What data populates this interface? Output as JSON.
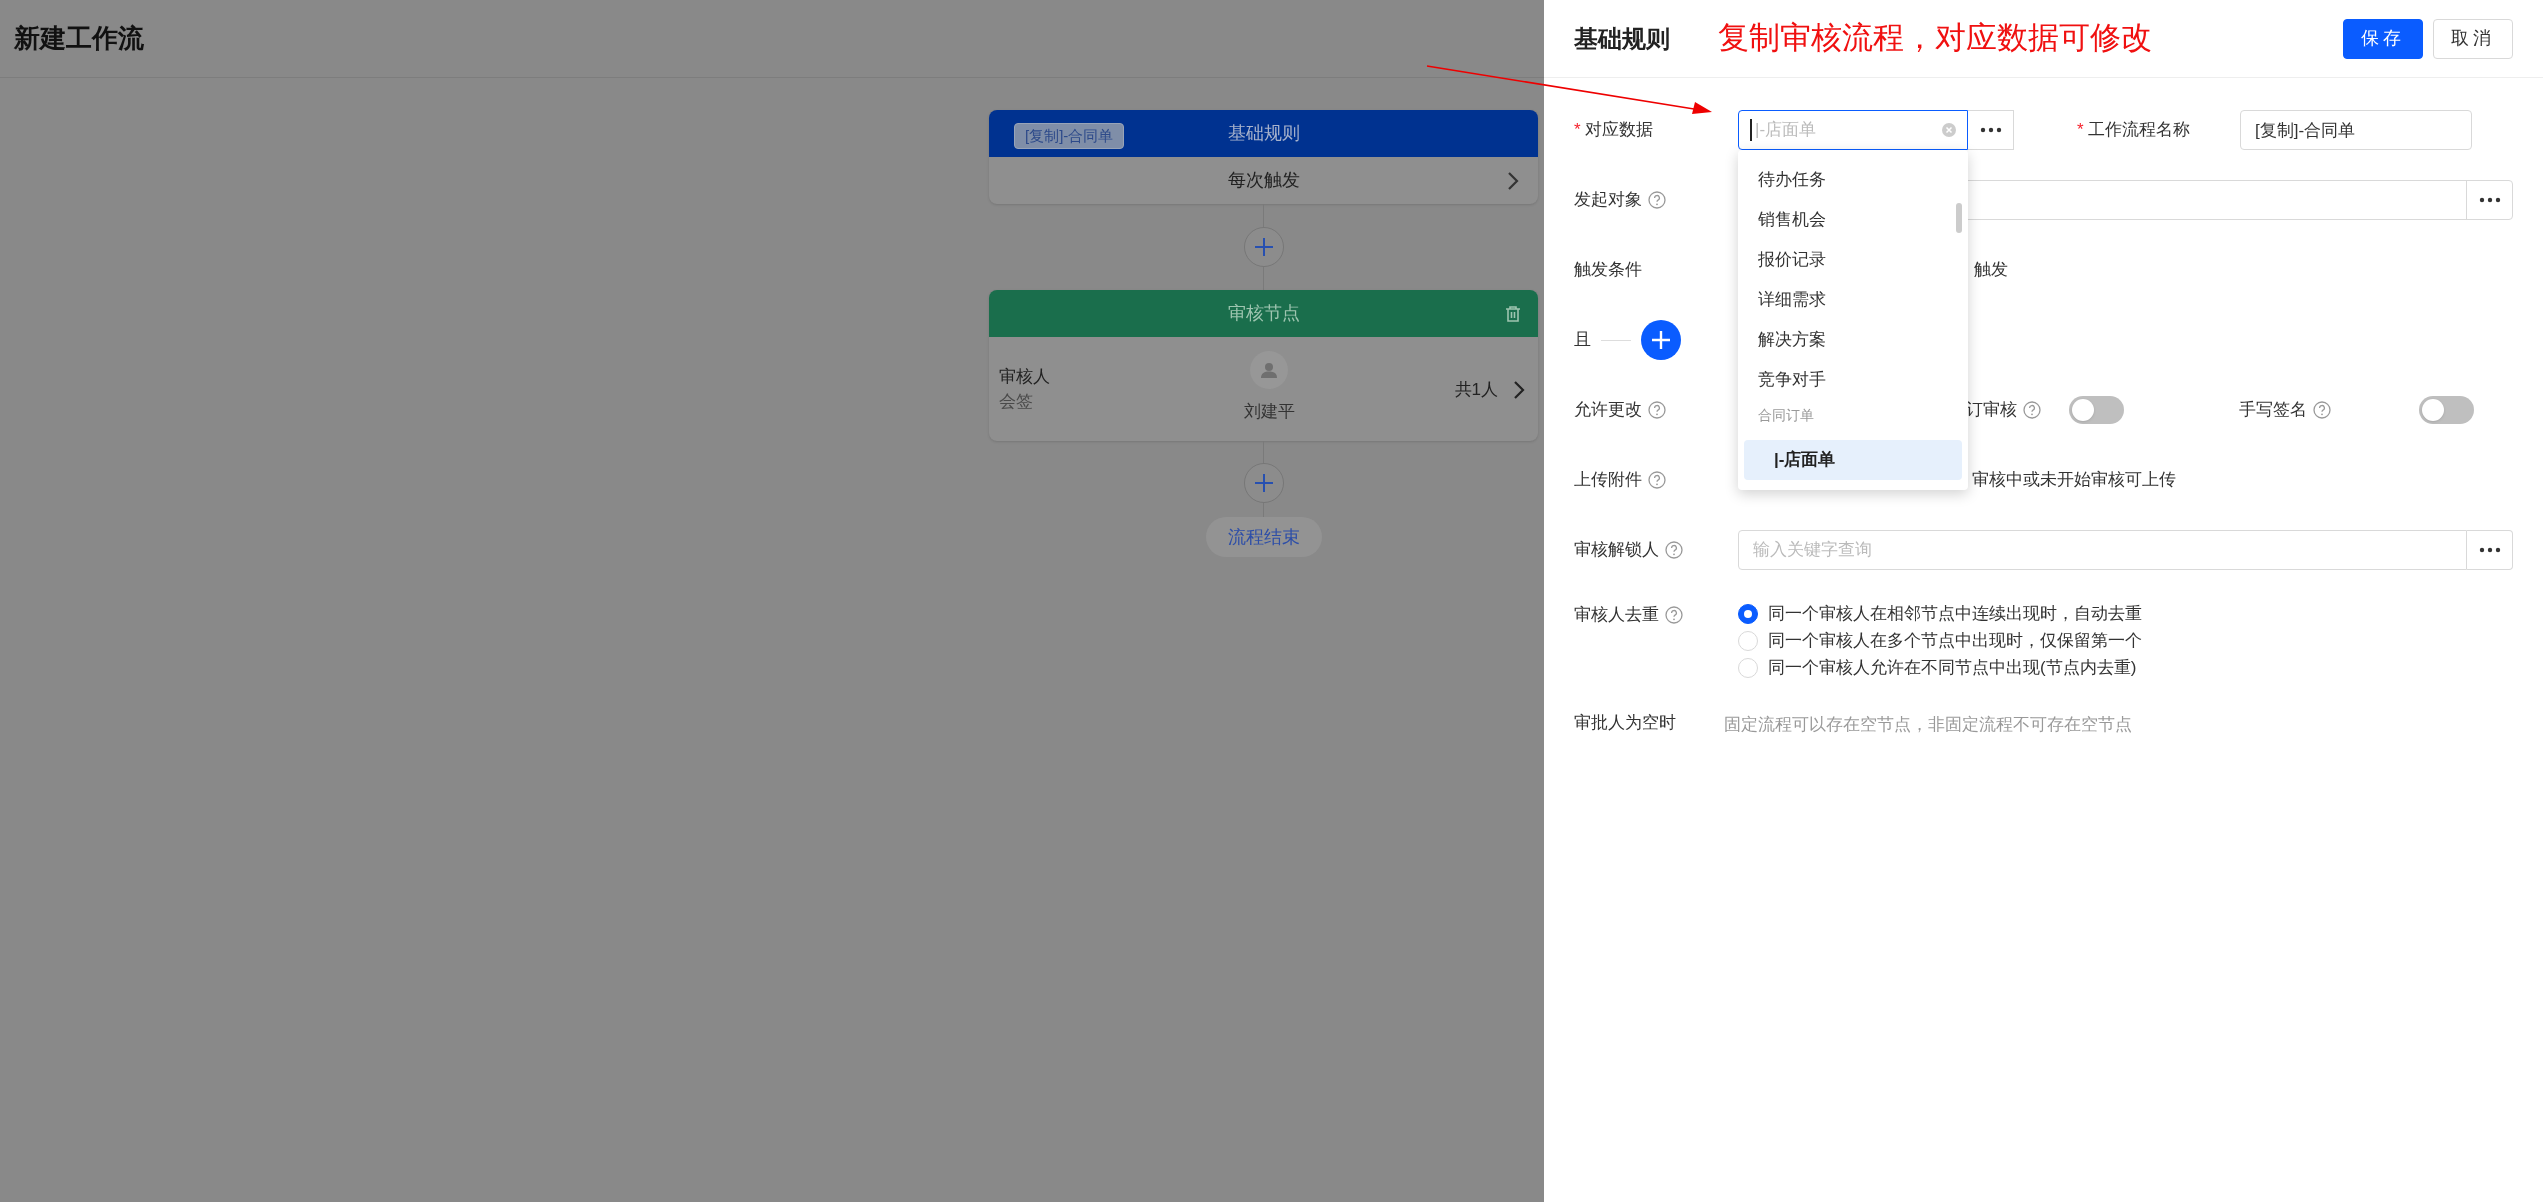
{
  "page_title": "新建工作流",
  "required_mark": "*",
  "flow": {
    "trigger_node": {
      "tag": "[复制]-合同单",
      "title": "基础规则",
      "body": "每次触发"
    },
    "approval_node": {
      "title": "审核节点",
      "role": "审核人",
      "mode": "会签",
      "person": "刘建平",
      "count": "共1人"
    },
    "end_label": "流程结束"
  },
  "panel": {
    "title": "基础规则",
    "annotation": "复制审核流程，对应数据可修改",
    "buttons": [
      {
        "label": "保存",
        "kind": "primary"
      },
      {
        "label": "取消",
        "kind": "default"
      }
    ],
    "data_field": {
      "label": "对应数据",
      "required": true,
      "placeholder": "|-店面单",
      "focused": true
    },
    "name_field": {
      "label": "工作流程名称",
      "required": true,
      "value": "[复制]-合同单"
    },
    "initiator": {
      "label": "发起对象"
    },
    "trigger": {
      "label": "触发条件",
      "value": "触发"
    },
    "and_label": "且",
    "allow_edit": {
      "label": "允许更改"
    },
    "toggles": [
      {
        "label": "订审核",
        "on": false
      },
      {
        "label": "手写签名",
        "on": false
      }
    ],
    "upload": {
      "label": "上传附件",
      "option": "审核中或未开始审核可上传"
    },
    "unlocker": {
      "label": "审核解锁人",
      "placeholder": "输入关键字查询"
    },
    "dedupe": {
      "label": "审核人去重",
      "options": [
        {
          "label": "同一个审核人在相邻节点中连续出现时，自动去重",
          "selected": true
        },
        {
          "label": "同一个审核人在多个节点中出现时，仅保留第一个",
          "selected": false
        },
        {
          "label": "同一个审核人允许在不同节点中出现(节点内去重)",
          "selected": false
        }
      ]
    },
    "empty_approver": {
      "label": "审批人为空时",
      "note": "固定流程可以存在空节点，非固定流程不可存在空节点"
    },
    "dropdown": {
      "items": [
        {
          "label": "待办任务",
          "kind": "option",
          "selected": false
        },
        {
          "label": "销售机会",
          "kind": "option",
          "selected": false
        },
        {
          "label": "报价记录",
          "kind": "option",
          "selected": false
        },
        {
          "label": "详细需求",
          "kind": "option",
          "selected": false
        },
        {
          "label": "解决方案",
          "kind": "option",
          "selected": false
        },
        {
          "label": "竞争对手",
          "kind": "option",
          "selected": false
        },
        {
          "label": "合同订单",
          "kind": "group"
        },
        {
          "label": "|-店面单",
          "kind": "option",
          "selected": true
        }
      ]
    }
  }
}
